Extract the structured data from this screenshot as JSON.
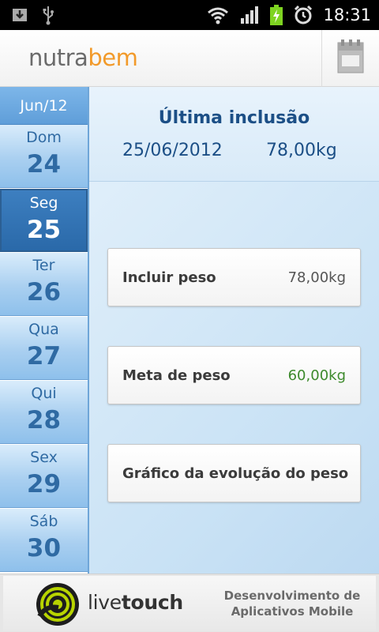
{
  "status_bar": {
    "time": "18:31",
    "left_icons": [
      "download-icon",
      "usb-icon"
    ],
    "right_icons": [
      "wifi-icon",
      "signal-icon",
      "battery-charging-icon",
      "alarm-icon"
    ]
  },
  "header": {
    "logo_part1": "nutra",
    "logo_part2": "bem",
    "logo_color_1": "#6b6b6b",
    "logo_color_2": "#f29a2a",
    "calendar_button_icon": "calendar-icon"
  },
  "calendar": {
    "month": "Jun/12",
    "days": [
      {
        "name": "Dom",
        "num": "24"
      },
      {
        "name": "Seg",
        "num": "25",
        "selected": true
      },
      {
        "name": "Ter",
        "num": "26"
      },
      {
        "name": "Qua",
        "num": "27"
      },
      {
        "name": "Qui",
        "num": "28"
      },
      {
        "name": "Sex",
        "num": "29"
      },
      {
        "name": "Sáb",
        "num": "30"
      }
    ]
  },
  "last_entry": {
    "title": "Última inclusão",
    "date": "25/06/2012",
    "weight": "78,00kg"
  },
  "actions": {
    "include_weight": {
      "label": "Incluir peso",
      "value": "78,00kg"
    },
    "weight_goal": {
      "label": "Meta de peso",
      "value": "60,00kg",
      "value_color": "#3d8a2c"
    },
    "weight_chart": {
      "label": "Gráfico da evolução do peso"
    }
  },
  "footer": {
    "brand_part1": "live",
    "brand_part2": "touch",
    "tagline_1": "Desenvolvimento de",
    "tagline_2": "Aplicativos Mobile"
  }
}
